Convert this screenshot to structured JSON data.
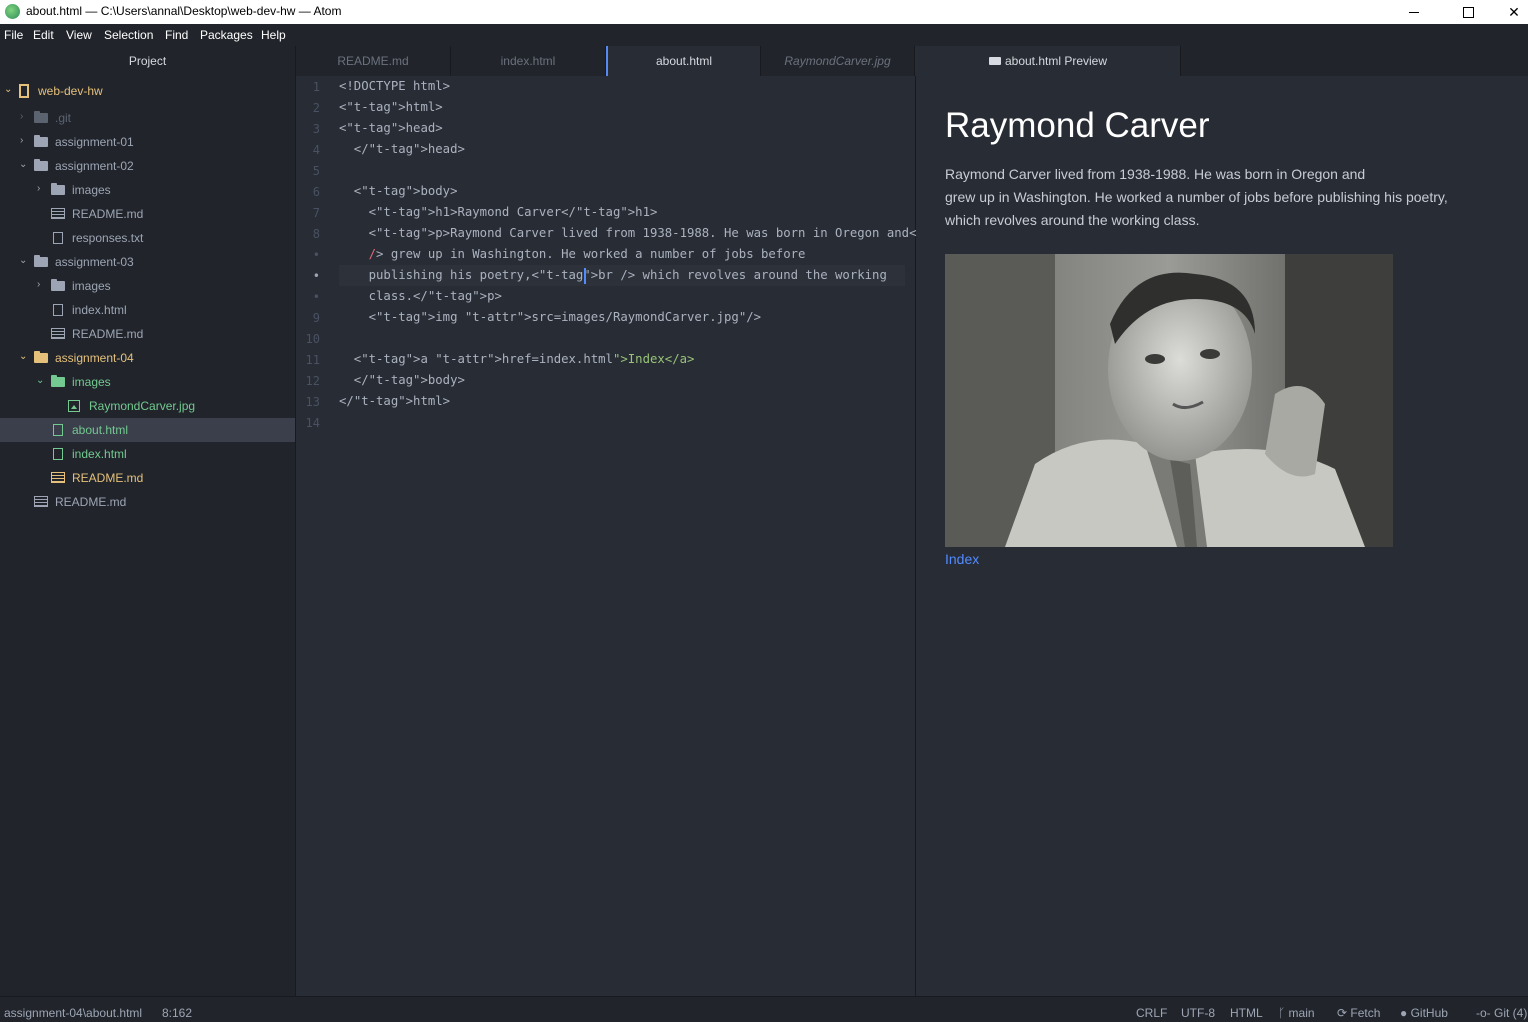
{
  "window": {
    "title": "about.html — C:\\Users\\annal\\Desktop\\web-dev-hw — Atom"
  },
  "menu": [
    "File",
    "Edit",
    "View",
    "Selection",
    "Find",
    "Packages",
    "Help"
  ],
  "sidebar": {
    "header": "Project",
    "items": [
      {
        "label": "web-dev-hw",
        "type": "repo",
        "state": "expanded",
        "color": "yellow"
      },
      {
        "label": ".git",
        "type": "folder",
        "state": "collapsed",
        "color": "dim"
      },
      {
        "label": "assignment-01",
        "type": "folder",
        "state": "collapsed",
        "color": "default"
      },
      {
        "label": "assignment-02",
        "type": "folder",
        "state": "expanded",
        "color": "default"
      },
      {
        "label": "images",
        "type": "folder",
        "state": "collapsed",
        "color": "default"
      },
      {
        "label": "README.md",
        "type": "markdown",
        "color": "default"
      },
      {
        "label": "responses.txt",
        "type": "file",
        "color": "default"
      },
      {
        "label": "assignment-03",
        "type": "folder",
        "state": "expanded",
        "color": "default"
      },
      {
        "label": "images",
        "type": "folder",
        "state": "collapsed",
        "color": "default"
      },
      {
        "label": "index.html",
        "type": "file",
        "color": "default"
      },
      {
        "label": "README.md",
        "type": "markdown",
        "color": "default"
      },
      {
        "label": "assignment-04",
        "type": "folder",
        "state": "expanded",
        "color": "yellow"
      },
      {
        "label": "images",
        "type": "folder",
        "state": "expanded",
        "color": "green"
      },
      {
        "label": "RaymondCarver.jpg",
        "type": "image",
        "color": "green"
      },
      {
        "label": "about.html",
        "type": "file",
        "color": "green",
        "selected": true
      },
      {
        "label": "index.html",
        "type": "file",
        "color": "green"
      },
      {
        "label": "README.md",
        "type": "markdown",
        "color": "yellow"
      },
      {
        "label": "README.md",
        "type": "markdown",
        "color": "default"
      }
    ]
  },
  "tabs": [
    {
      "label": "README.md",
      "active": false
    },
    {
      "label": "index.html",
      "active": false
    },
    {
      "label": "about.html",
      "active": true
    },
    {
      "label": "RaymondCarver.jpg",
      "active": false,
      "italic": true
    }
  ],
  "preview_tab": {
    "label": "about.html Preview",
    "icon": "markdown-icon"
  },
  "editor": {
    "line_numbers": [
      "1",
      "2",
      "3",
      "4",
      "5",
      "6",
      "7",
      "8",
      "•",
      "•",
      "•",
      "9",
      "10",
      "11",
      "12",
      "13",
      "14"
    ],
    "lines": [
      "<!DOCTYPE html>",
      "<html>",
      "<head>",
      "  </head>",
      "",
      "  <body>",
      "    <h1>Raymond Carver</h1>",
      "    <p>Raymond Carver lived from 1938-1988. He was born in Oregon and<br",
      "    /> grew up in Washington. He worked a number of jobs before",
      "    publishing his poetry,<br /> which revolves around the working",
      "    class.</p>",
      "    <img src=\"images/RaymondCarver.jpg\"/>",
      "",
      "  <a href=\"index.html\">Index</a>",
      "  </body>",
      "</html>",
      ""
    ]
  },
  "preview": {
    "heading": "Raymond Carver",
    "paragraph_lines": [
      "Raymond Carver lived from 1938-1988. He was born in Oregon and",
      "grew up in Washington. He worked a number of jobs before publishing his poetry,",
      "which revolves around the working class."
    ],
    "link": "Index"
  },
  "status": {
    "path": "assignment-04\\about.html",
    "cursor": "8:162",
    "line_ending": "CRLF",
    "encoding": "UTF-8",
    "grammar": "HTML",
    "branch": "main",
    "fetch": "Fetch",
    "github": "GitHub",
    "git": "Git (4)"
  },
  "colors": {
    "accent": "#568af2",
    "git_added": "#73c990",
    "git_modified": "#e5c07b",
    "editor_bg": "#282c34",
    "panel_bg": "#21252b"
  }
}
